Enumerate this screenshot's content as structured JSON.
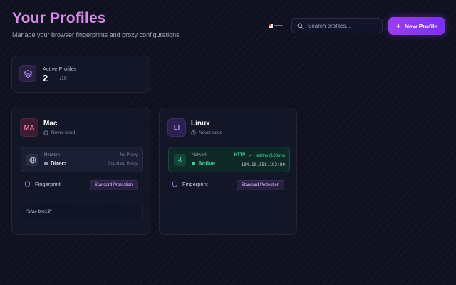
{
  "header": {
    "title": "Your Profiles",
    "subtitle": "Manage your browser fingerprints and proxy configurations"
  },
  "search": {
    "placeholder": "Search profiles...",
    "icon": "search-icon"
  },
  "new_profile_button": {
    "label": "New Profile",
    "icon": "plus-icon"
  },
  "stats": {
    "label": "Active Profiles",
    "value": "2",
    "max": "/10",
    "icon": "layers-icon"
  },
  "profiles": [
    {
      "initials": "MA",
      "name": "Mac",
      "last_used": "Never used",
      "network": {
        "label": "Network",
        "state": "Direct",
        "right_top": "No Proxy",
        "right_bottom": "Standard Relay",
        "icon": "globe-icon"
      },
      "fingerprint_label": "Fingerprint",
      "protection": "Standard Protection",
      "note": "\"Mac bro13\""
    },
    {
      "initials": "LI",
      "name": "Linux",
      "last_used": "Never used",
      "network": {
        "label": "Network",
        "state": "Active",
        "protocol": "HTTP",
        "health": "✓ Healthy (133ms)",
        "ip": "104.18.158.193:80",
        "icon": "zap-icon"
      },
      "fingerprint_label": "Fingerprint",
      "protection": "Standard Protection"
    }
  ],
  "colors": {
    "accent": "#9b3df0",
    "title": "#d98be6",
    "success": "#34d399",
    "background": "#0f1120"
  }
}
